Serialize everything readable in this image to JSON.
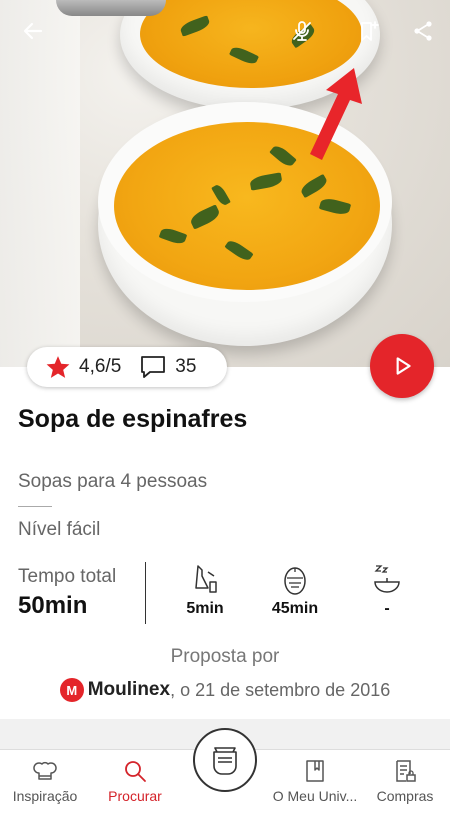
{
  "header": {
    "back_icon": "arrow-left-icon",
    "mic_icon": "mic-off-icon",
    "bookmark_icon": "bookmark-add-icon",
    "share_icon": "share-icon"
  },
  "rating": {
    "score": "4,6/5",
    "comments": "35",
    "star_color": "#e4252a"
  },
  "recipe": {
    "title": "Sopa de espinafres",
    "category": "Sopas para 4 pessoas",
    "level": "Nível fácil",
    "total_time_label": "Tempo total",
    "total_time_value": "50min",
    "steps": [
      {
        "icon": "prep-icon",
        "value": "5min"
      },
      {
        "icon": "timer-egg-icon",
        "value": "45min"
      },
      {
        "icon": "rest-icon",
        "value": "-"
      }
    ]
  },
  "author": {
    "proposed_by": "Proposta por",
    "brand": "Moulinex",
    "date_text": ", o 21 de setembro de 2016"
  },
  "nav": {
    "items": [
      {
        "label": "Inspiração",
        "icon": "chef-hat-icon"
      },
      {
        "label": "Procurar",
        "icon": "search-icon"
      },
      {
        "label": "O Meu Univ...",
        "icon": "book-icon"
      },
      {
        "label": "Compras",
        "icon": "shopping-list-icon"
      }
    ],
    "center_icon": "cooking-machine-icon",
    "accent": "#d4232a"
  }
}
